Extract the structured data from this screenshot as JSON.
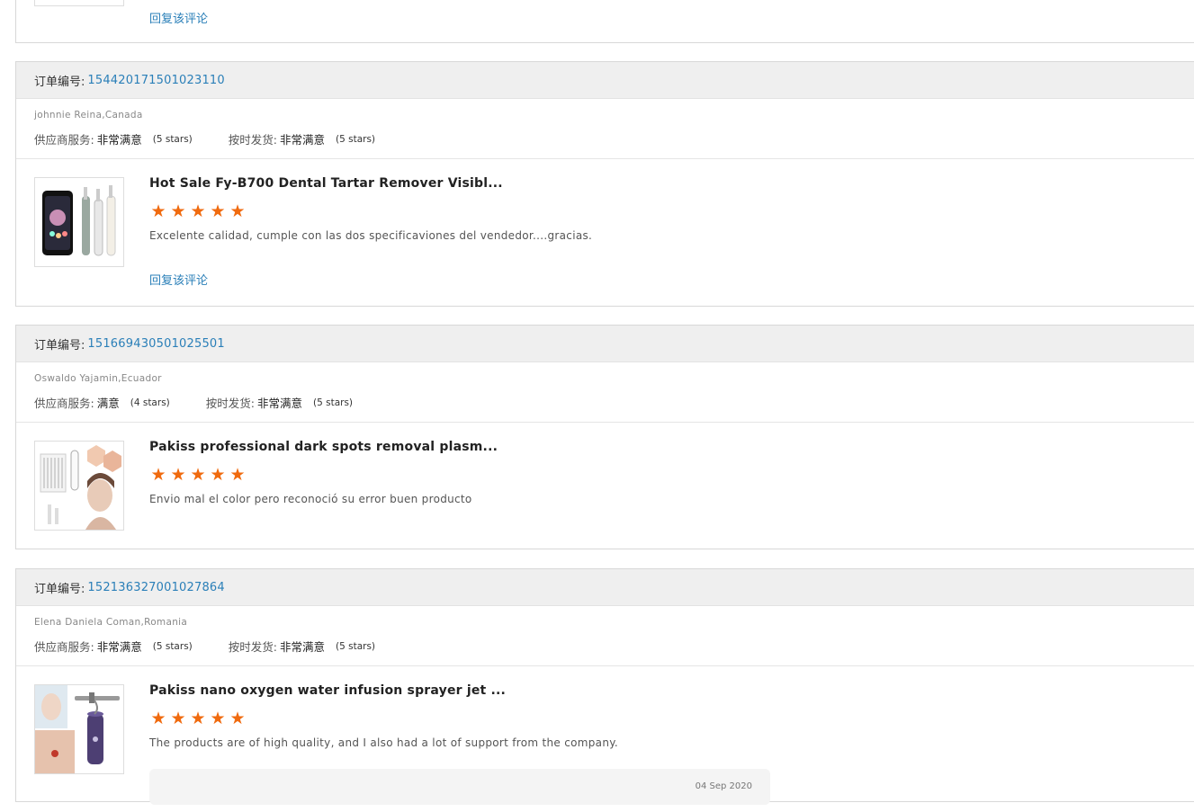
{
  "top_partial": {
    "reply_label": "回复该评论"
  },
  "orders": [
    {
      "order_label": "订单编号:",
      "order_number": "154420171501023110",
      "buyer": "johnnie Reina,Canada",
      "supplier_label": "供应商服务:",
      "supplier_value": "非常满意",
      "supplier_stars": "(5 stars)",
      "shipping_label": "按时发货:",
      "shipping_value": "非常满意",
      "shipping_stars": "(5 stars)",
      "product_title": "Hot Sale Fy-B700 Dental Tartar Remover Visibl...",
      "rating": 5,
      "comment": "Excelente calidad, cumple con las dos specificaviones del vendedor....gracias.",
      "reply_label": "回复该评论"
    },
    {
      "order_label": "订单编号:",
      "order_number": "151669430501025501",
      "buyer": "Oswaldo Yajamin,Ecuador",
      "supplier_label": "供应商服务:",
      "supplier_value": "满意",
      "supplier_stars": "(4 stars)",
      "shipping_label": "按时发货:",
      "shipping_value": "非常满意",
      "shipping_stars": "(5 stars)",
      "product_title": "Pakiss professional dark spots removal plasm...",
      "rating": 5,
      "comment": "Envio mal el color pero reconoció su error buen producto"
    },
    {
      "order_label": "订单编号:",
      "order_number": "152136327001027864",
      "buyer": "Elena Daniela Coman,Romania",
      "supplier_label": "供应商服务:",
      "supplier_value": "非常满意",
      "supplier_stars": "(5 stars)",
      "shipping_label": "按时发货:",
      "shipping_value": "非常满意",
      "shipping_stars": "(5 stars)",
      "product_title": "Pakiss nano oxygen water infusion sprayer jet ...",
      "rating": 5,
      "comment": "The products are of high quality, and I also had a lot of support from the company.",
      "seller_reply_date": "04 Sep 2020"
    }
  ],
  "colors": {
    "link": "#2a7fb8",
    "star": "#f06a0e",
    "header_bg": "#efefef"
  }
}
